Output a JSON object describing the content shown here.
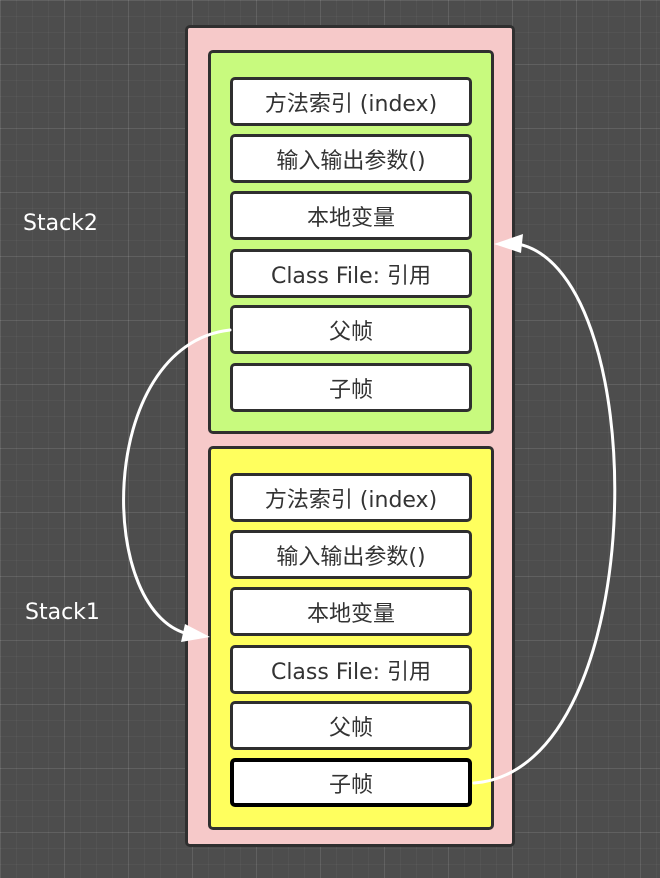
{
  "stacks": {
    "stack2": {
      "label": "Stack2",
      "fields": [
        "方法索引 (index)",
        "输入输出参数()",
        "本地变量",
        "Class File: 引用",
        "父帧",
        "子帧"
      ]
    },
    "stack1": {
      "label": "Stack1",
      "fields": [
        "方法索引 (index)",
        "输入输出参数()",
        "本地变量",
        "Class File: 引用",
        "父帧",
        "子帧"
      ]
    }
  },
  "colors": {
    "background": "#4d4d4d",
    "outer_container": "#f6c9c9",
    "stack2_frame": "#c8fa7e",
    "stack1_frame": "#ffff5e",
    "field": "#ffffff",
    "arrow": "#ffffff"
  },
  "connections": [
    {
      "from": "Stack2.父帧",
      "to": "Stack1"
    },
    {
      "from": "Stack1.子帧",
      "to": "Stack2"
    }
  ]
}
